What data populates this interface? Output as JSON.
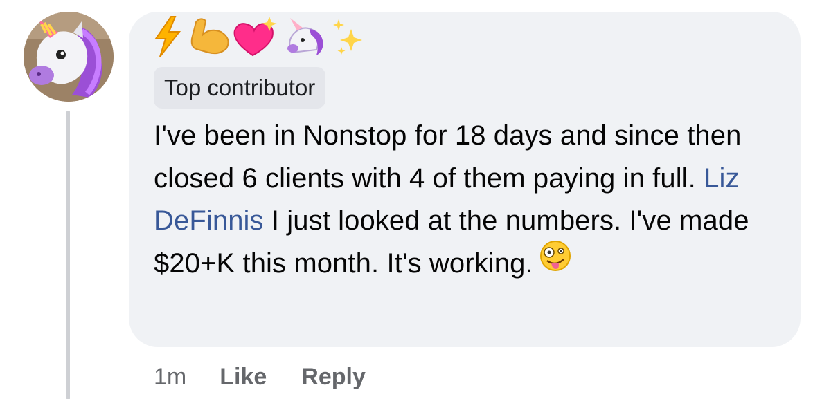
{
  "comment": {
    "author_flair_icons": [
      "lightning-icon",
      "flexed-biceps-icon",
      "sparkling-heart-icon",
      "unicorn-icon",
      "sparkles-icon"
    ],
    "badge": "Top contributor",
    "text_before_mention": "I've been in Nonstop for 18 days and since then closed 6 clients with 4 of them paying in full. ",
    "mention": "Liz DeFinnis",
    "text_after_mention": " I just looked at the numbers. I've made $20+K this month. It's working.",
    "trailing_emoji": "zany-face-icon",
    "timestamp": "1m",
    "like_label": "Like",
    "reply_label": "Reply"
  },
  "colors": {
    "bubble": "#f0f2f5",
    "badge": "#e4e6eb",
    "mention": "#385898",
    "meta": "#65676b",
    "text": "#050505"
  }
}
